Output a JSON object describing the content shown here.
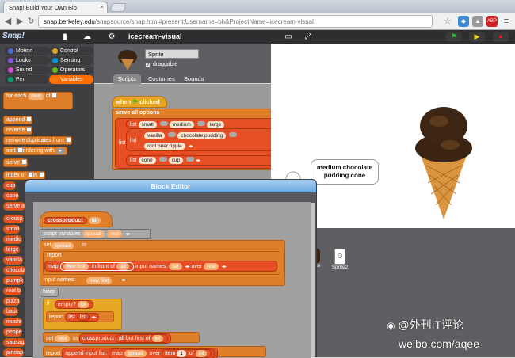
{
  "browser": {
    "tab_title": "Snap! Build Your Own Blo",
    "url_host": "snap.berkeley.edu",
    "url_path": "/snapsource/snap.html#present:Username=bh&ProjectName=icecream-visual"
  },
  "snap": {
    "logo": "Snap!",
    "project_title": "icecream-visual"
  },
  "categories": [
    {
      "label": "Motion",
      "color": "#4a6cd4"
    },
    {
      "label": "Control",
      "color": "#e6a822"
    },
    {
      "label": "Looks",
      "color": "#8a55d7"
    },
    {
      "label": "Sensing",
      "color": "#0494dc"
    },
    {
      "label": "Sound",
      "color": "#cf4ad9"
    },
    {
      "label": "Operators",
      "color": "#62c213"
    },
    {
      "label": "Pen",
      "color": "#0e9a6c"
    },
    {
      "label": "Variables",
      "color": "#ee7d16"
    }
  ],
  "palette": {
    "for_each": "for each",
    "item": "item",
    "of": "of",
    "append": "append",
    "reverse": "reverse",
    "remove_dups": "remove duplicates from",
    "sort": "sort",
    "ordering_with": "ordering with",
    "serve": "serve",
    "index_of": "index of",
    "in": "in",
    "cup": "cup",
    "cone": "cone",
    "serve_a": "serve a",
    "crossp": "crossp",
    "small": "small",
    "medium": "mediu",
    "large": "large",
    "vanilla": "vanilla",
    "chocolate": "chocola",
    "pumpkin": "pumpk",
    "root_beer": "root b",
    "pizza": "pizza",
    "basil": "basil",
    "mushroom": "mushr",
    "pepper": "peppe",
    "sausage": "sausag",
    "pineapple": "pineap"
  },
  "sprite": {
    "name": "Sprite",
    "draggable": "draggable",
    "tabs": [
      "Scripts",
      "Costumes",
      "Sounds"
    ]
  },
  "script": {
    "when": "when",
    "clicked": "clicked",
    "serve_all": "serve all options",
    "list": "list",
    "row1": [
      "small",
      "medium",
      "large"
    ],
    "row2": [
      "vanilla",
      "chocolate pudding"
    ],
    "row2b": "root beer ripple",
    "row3": [
      "cone",
      "cup"
    ]
  },
  "stage": {
    "bubble_line1": "medium chocolate",
    "bubble_line2": "pudding cone"
  },
  "corral": {
    "sprite2": "Sprite2",
    "sprite1": "ite"
  },
  "editor": {
    "title": "Block Editor",
    "crossproduct": "crossproduct",
    "lol": "lol",
    "script_variables": "script variables",
    "spread": "spread",
    "rest": "rest",
    "set": "set",
    "to": "to",
    "report": "report",
    "map": "map",
    "new_first": "new first",
    "in_front_of": "in front of",
    "tail": "tail",
    "input_names": "input names:",
    "over": "over",
    "warp": "warp",
    "if": "if",
    "empty": "empty?",
    "list": "list",
    "all_but_first": "all but first of",
    "append_input": "append input list:",
    "item": "item",
    "one": "1",
    "of": "of"
  },
  "watermark": {
    "line1": "@外刊IT评论",
    "line2": "weibo.com/aqee"
  }
}
